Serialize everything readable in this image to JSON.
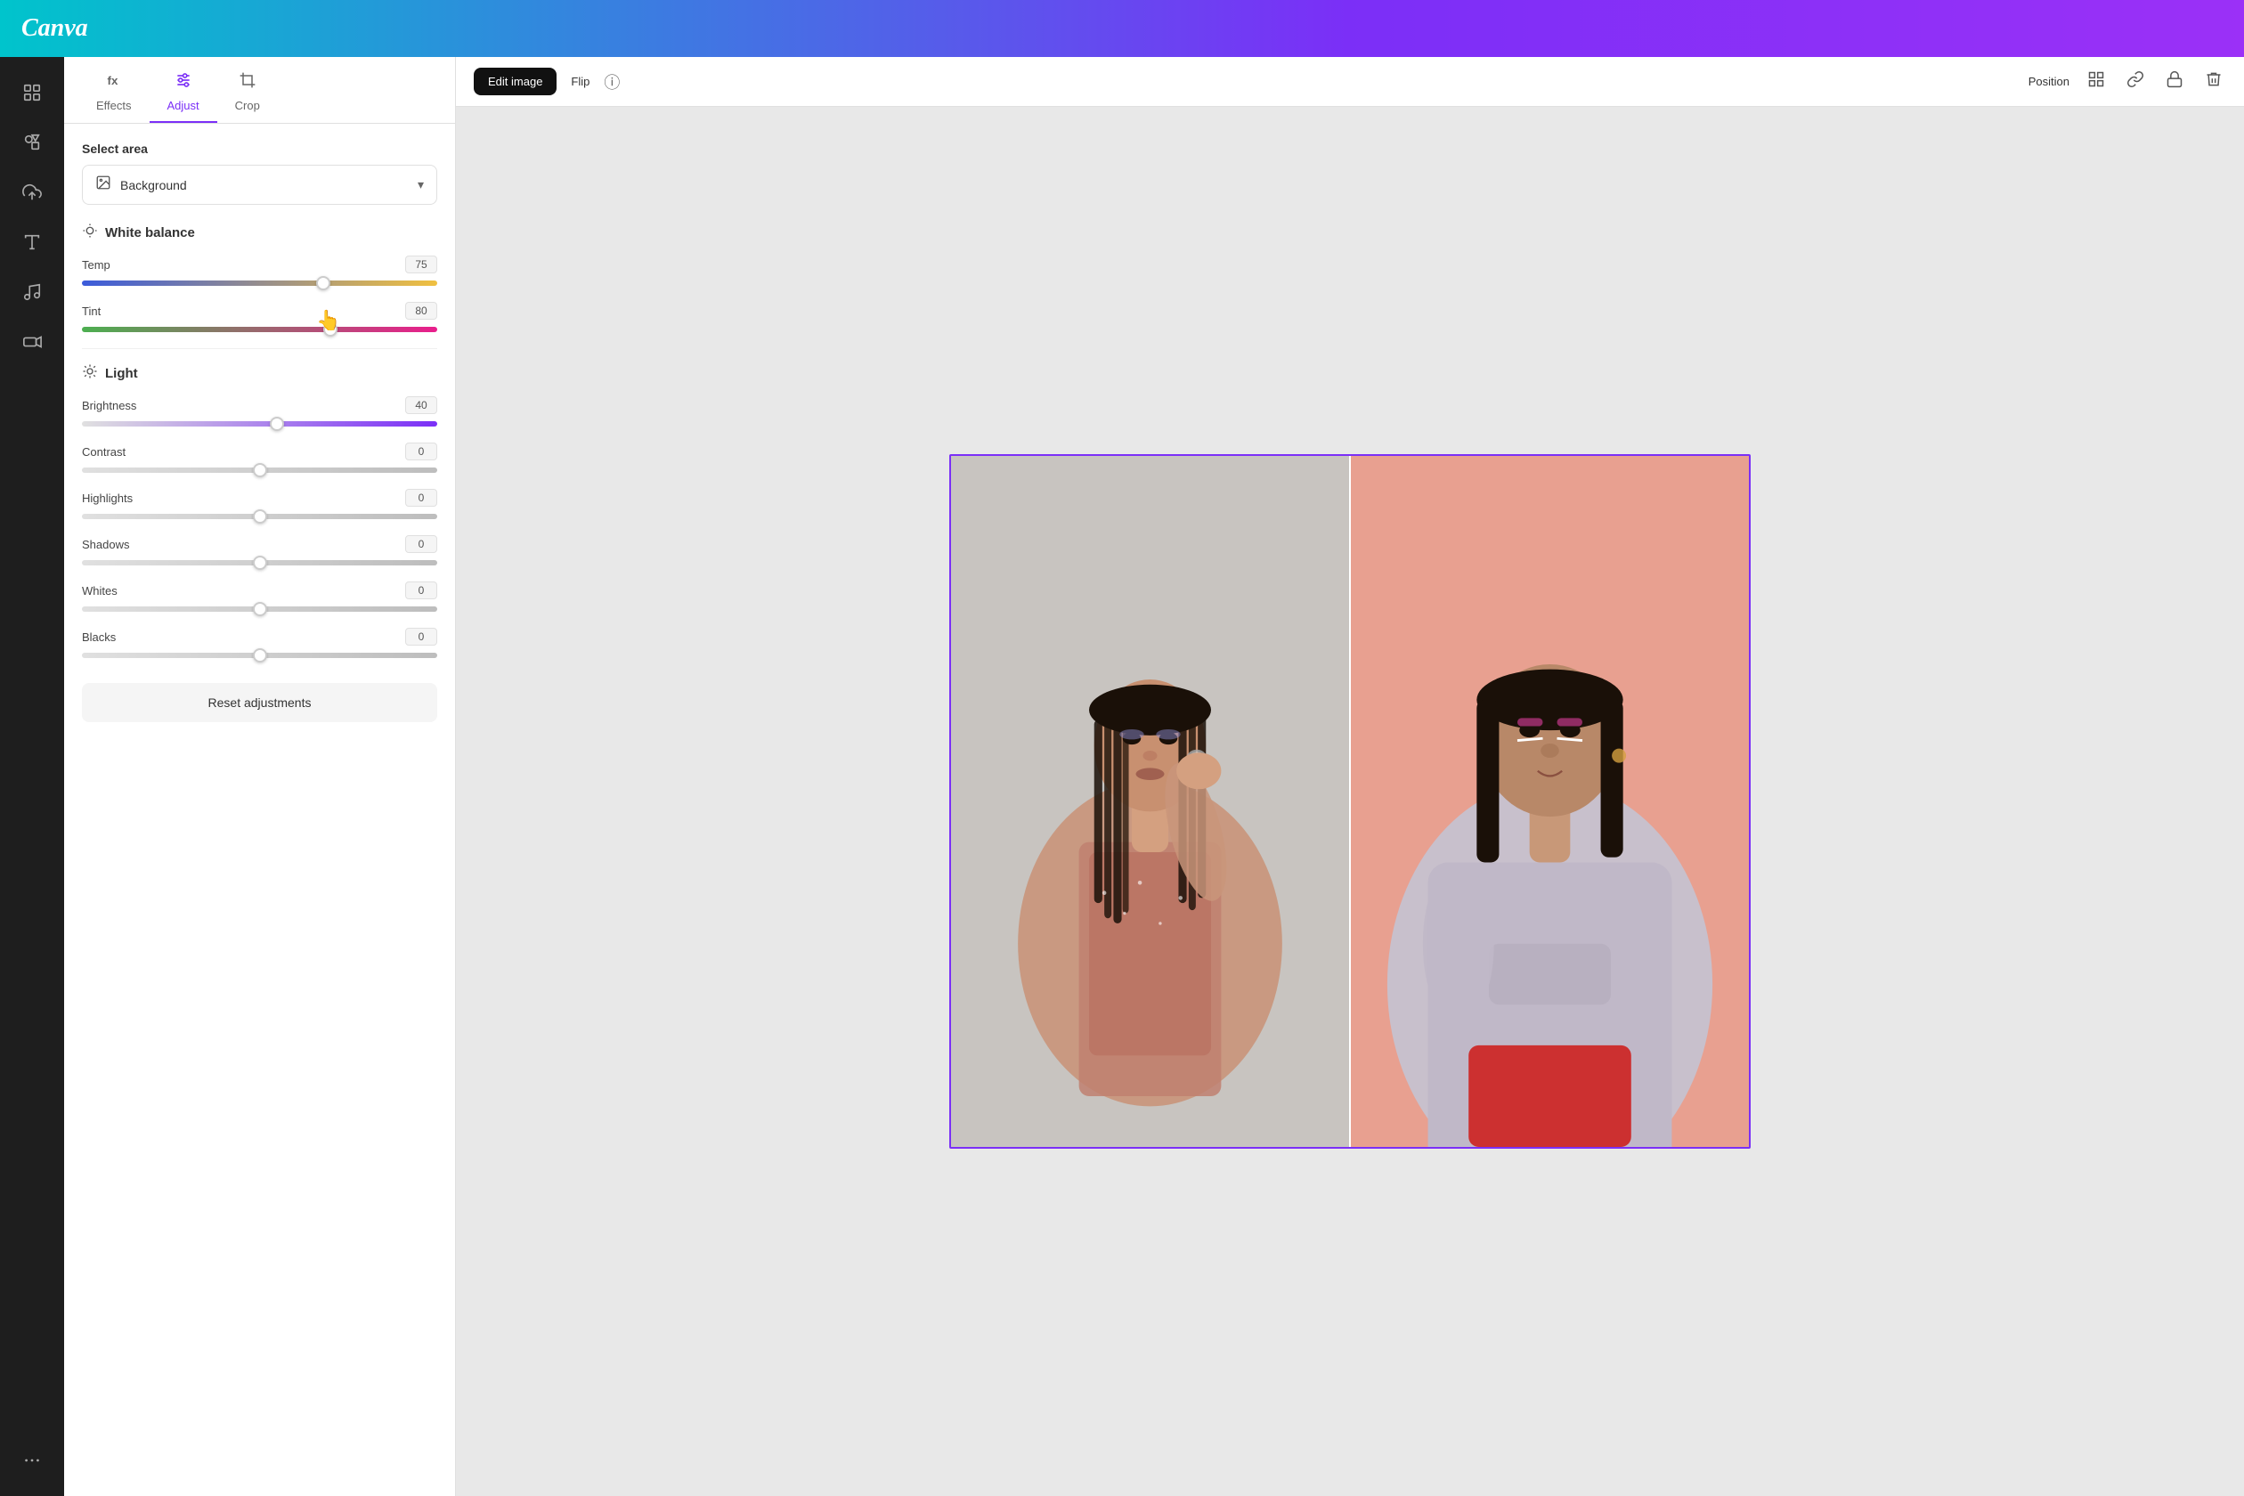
{
  "header": {
    "logo": "Canva"
  },
  "toolbar": {
    "edit_image_label": "Edit image",
    "flip_label": "Flip",
    "position_label": "Position",
    "delete_label": "Delete"
  },
  "tabs": [
    {
      "id": "effects",
      "label": "Effects",
      "icon": "fx"
    },
    {
      "id": "adjust",
      "label": "Adjust",
      "icon": "sliders",
      "active": true
    },
    {
      "id": "crop",
      "label": "Crop",
      "icon": "crop"
    }
  ],
  "panel": {
    "select_area_label": "Select area",
    "area_dropdown": {
      "value": "Background",
      "placeholder": "Background"
    },
    "white_balance": {
      "section_title": "White balance",
      "temp": {
        "label": "Temp",
        "value": "75",
        "percent": 68
      },
      "tint": {
        "label": "Tint",
        "value": "80",
        "percent": 70
      }
    },
    "light": {
      "section_title": "Light",
      "brightness": {
        "label": "Brightness",
        "value": "40",
        "percent": 55
      },
      "contrast": {
        "label": "Contrast",
        "value": "0",
        "percent": 50
      },
      "highlights": {
        "label": "Highlights",
        "value": "0",
        "percent": 50
      },
      "shadows": {
        "label": "Shadows",
        "value": "0",
        "percent": 50
      },
      "whites": {
        "label": "Whites",
        "value": "0",
        "percent": 50
      },
      "blacks": {
        "label": "Blacks",
        "value": "0",
        "percent": 50
      }
    },
    "reset_button_label": "Reset adjustments"
  },
  "icon_bar": [
    {
      "id": "dashboard",
      "icon": "⊞"
    },
    {
      "id": "elements",
      "icon": "❖"
    },
    {
      "id": "upload",
      "icon": "↑"
    },
    {
      "id": "text",
      "icon": "T"
    },
    {
      "id": "music",
      "icon": "♪"
    },
    {
      "id": "video",
      "icon": "▶"
    },
    {
      "id": "more",
      "icon": "···"
    }
  ]
}
